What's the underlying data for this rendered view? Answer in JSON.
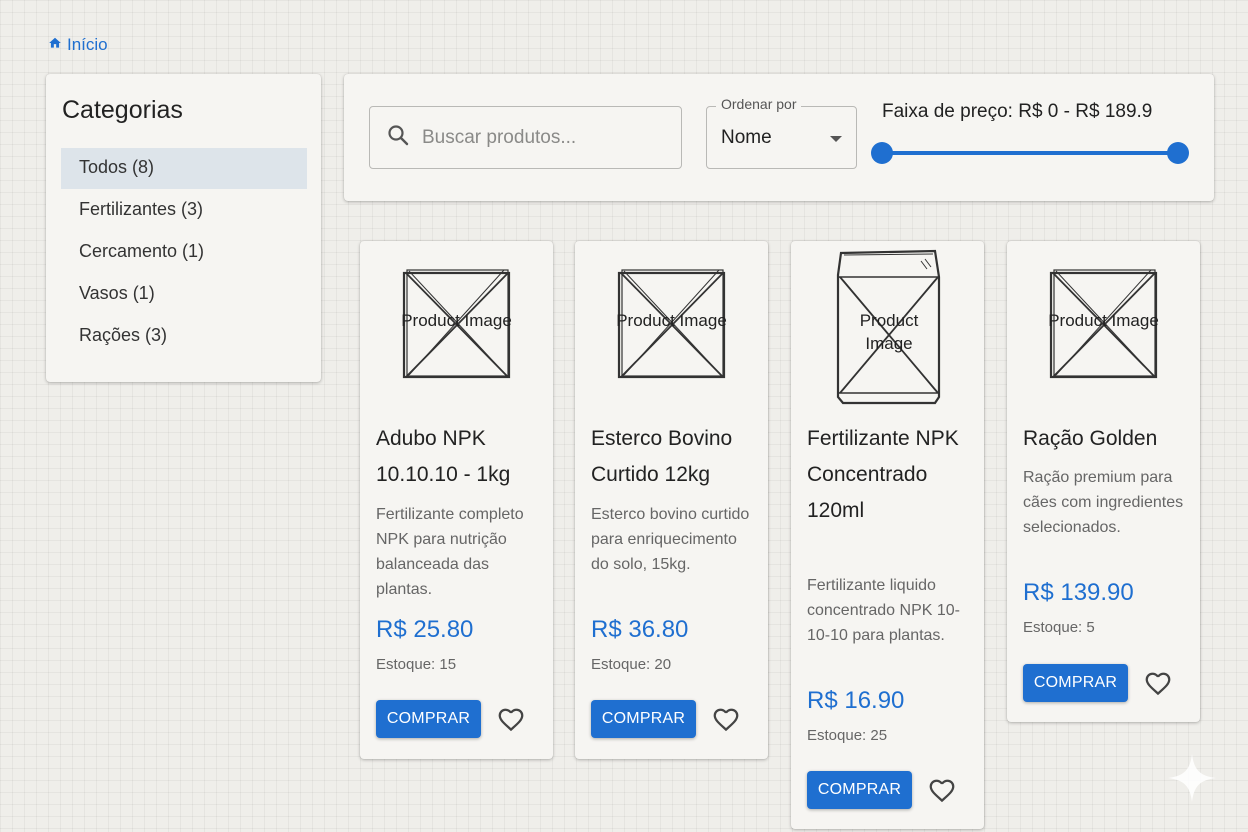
{
  "breadcrumb": {
    "home_label": "Início",
    "home_icon": "home-icon"
  },
  "sidebar": {
    "title": "Categorias",
    "items": [
      {
        "label": "Todos (8)",
        "active": true
      },
      {
        "label": "Fertilizantes (3)",
        "active": false
      },
      {
        "label": "Cercamento (1)",
        "active": false
      },
      {
        "label": "Vasos (1)",
        "active": false
      },
      {
        "label": "Rações (3)",
        "active": false
      }
    ]
  },
  "filters": {
    "search_placeholder": "Buscar produtos...",
    "search_value": "",
    "sort_label": "Ordenar por",
    "sort_value": "Nome",
    "price_label": "Faixa de preço: R$ 0 - R$ 189.9",
    "price_min": 0,
    "price_max": 189.9,
    "range_bounds": [
      0,
      189.9
    ]
  },
  "image_placeholder_label": "Product Image",
  "products": [
    {
      "name": "Adubo NPK 10.10.10 - 1kg",
      "description": "Fertilizante completo NPK para nutrição balanceada das plantas.",
      "price": "R$ 25.80",
      "stock": "Estoque: 15",
      "buy_label": "COMPRAR"
    },
    {
      "name": "Esterco Bovino Curtido 12kg",
      "description": "Esterco bovino curtido para enriquecimento do solo, 15kg.",
      "price": "R$ 36.80",
      "stock": "Estoque: 20",
      "buy_label": "COMPRAR"
    },
    {
      "name": "Fertilizante NPK Concentrado 120ml",
      "description": "Fertilizante liquido concentrado NPK 10-10-10 para plantas.",
      "price": "R$ 16.90",
      "stock": "Estoque: 25",
      "buy_label": "COMPRAR"
    },
    {
      "name": "Ração Golden",
      "description": "Ração premium para cães com ingredientes selecionados.",
      "price": "R$ 139.90",
      "stock": "Estoque: 5",
      "buy_label": "COMPRAR"
    }
  ],
  "colors": {
    "accent": "#1f6fd0",
    "background": "#efeeea",
    "panel": "#f6f5f2",
    "active_category": "#dde4ea"
  }
}
